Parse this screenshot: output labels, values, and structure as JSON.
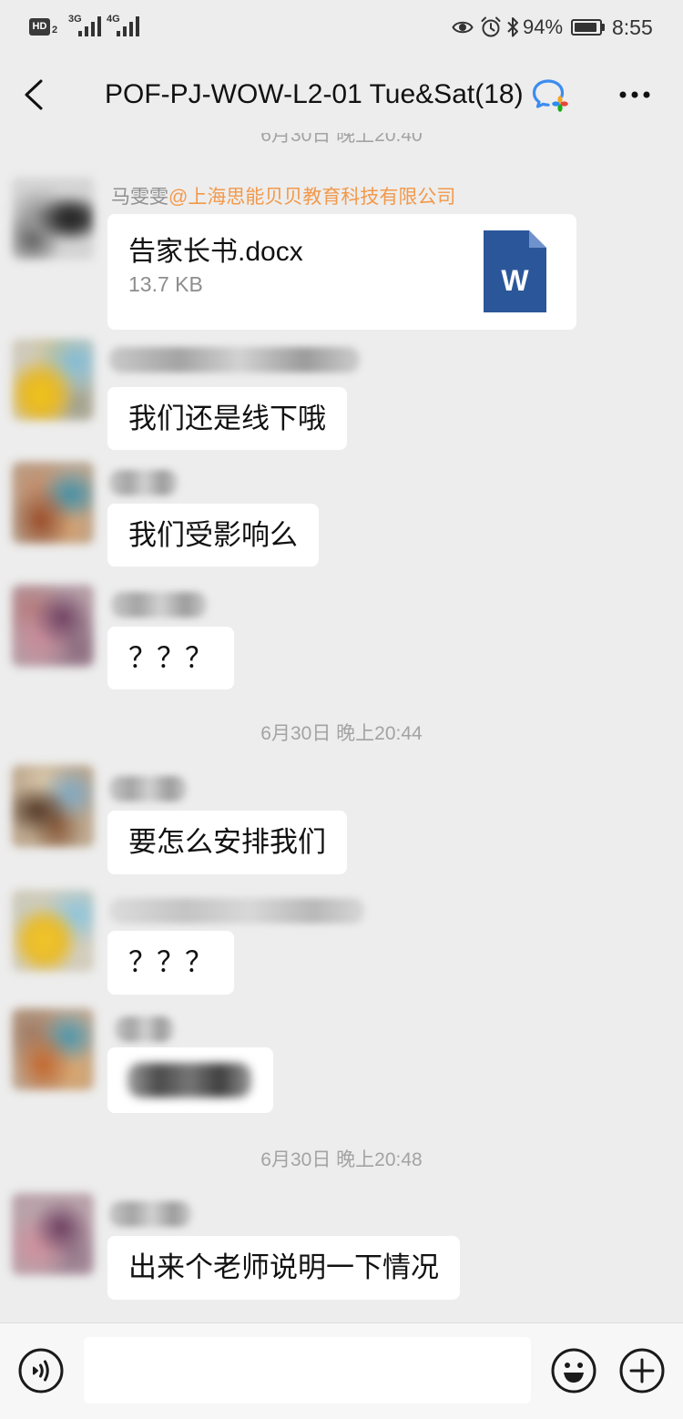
{
  "status_bar": {
    "hd_label": "HD",
    "hd_sub": "2",
    "sim1_network": "3G",
    "sim2_network": "4G",
    "eye_icon": "eye-icon",
    "alarm_icon": "alarm-icon",
    "bluetooth_icon": "bluetooth-icon",
    "battery_text": "94%",
    "battery_level": 0.94,
    "time": "8:55"
  },
  "header": {
    "back_icon": "chevron-left-icon",
    "title": "POF-PJ-WOW-L2-01 Tue&Sat(18)",
    "badge_icon": "enterprise-chat-icon",
    "more_icon": "more-dots-icon"
  },
  "chat": {
    "timestamps": [
      "6月30日 晚上20:40",
      "6月30日 晚上20:44",
      "6月30日 晚上20:48"
    ],
    "messages": [
      {
        "sender_name": "马雯雯",
        "sender_org": "@上海思能贝贝教育科技有限公司",
        "file_name": "告家长书.docx",
        "file_size": "13.7 KB",
        "file_icon": "word-document-icon",
        "file_icon_letter": "W"
      },
      {
        "text": "我们还是线下哦"
      },
      {
        "text": "我们受影响么"
      },
      {
        "text": "？？？"
      },
      {
        "text": "要怎么安排我们"
      },
      {
        "text": "？？？"
      },
      {},
      {
        "text": "出来个老师说明一下情况"
      }
    ]
  },
  "input_bar": {
    "voice_icon": "voice-input-icon",
    "input_value": "",
    "emoji_icon": "emoji-icon",
    "plus_icon": "plus-icon"
  },
  "colors": {
    "background": "#ededed",
    "bubble": "#ffffff",
    "sender_org": "#f2994a",
    "word_blue": "#2b579a",
    "badge_blue": "#3b8cf0"
  }
}
